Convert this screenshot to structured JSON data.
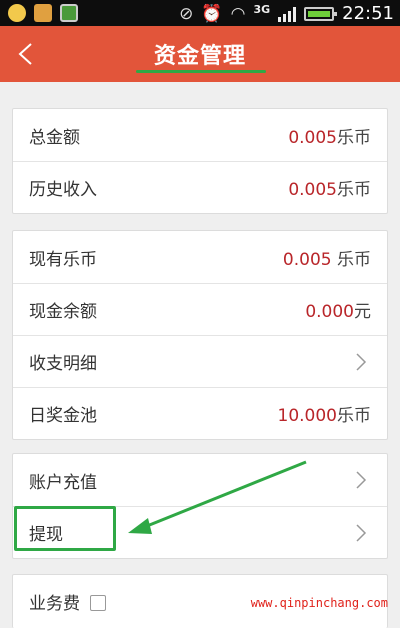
{
  "status_bar": {
    "left_icons": [
      "launcher-icon",
      "chat-icon",
      "gallery-icon"
    ],
    "network": "3G",
    "time": "22:51"
  },
  "header": {
    "back_icon": "chevron-left-icon",
    "title": "资金管理"
  },
  "summary": [
    {
      "label": "总金额",
      "value": "0.005",
      "unit": "乐币"
    },
    {
      "label": "历史收入",
      "value": "0.005",
      "unit": "乐币"
    }
  ],
  "balance": [
    {
      "label": "现有乐币",
      "value": "0.005",
      "unit": " 乐币"
    },
    {
      "label": "现金余额",
      "value": "0.000",
      "unit": "元"
    },
    {
      "label": "收支明细"
    },
    {
      "label": "日奖金池",
      "value": "10.000",
      "unit": "乐币"
    }
  ],
  "actions": [
    {
      "label": "账户充值"
    },
    {
      "label": "提现"
    }
  ],
  "fee": {
    "label": "业务费"
  },
  "watermark": "www.qinpinchang.com",
  "colors": {
    "header": "#e2553a",
    "value": "#b9262a",
    "annotation": "#2fa845"
  }
}
